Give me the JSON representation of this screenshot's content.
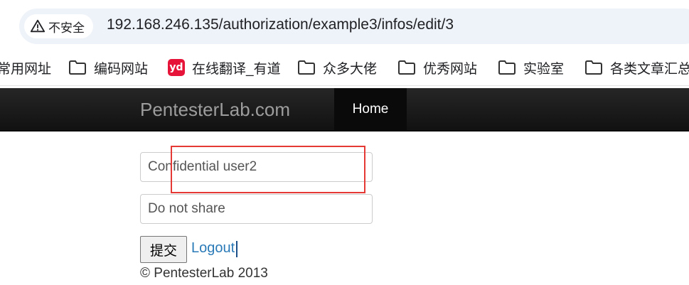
{
  "browser": {
    "security_label": "不安全",
    "url": "192.168.246.135/authorization/example3/infos/edit/3"
  },
  "bookmarks": [
    {
      "label": "常用网址",
      "icon": "none"
    },
    {
      "label": "编码网站",
      "icon": "folder-icon"
    },
    {
      "label": "在线翻译_有道",
      "icon": "youdao-icon"
    },
    {
      "label": "众多大佬",
      "icon": "folder-icon"
    },
    {
      "label": "优秀网站",
      "icon": "folder-icon"
    },
    {
      "label": "实验室",
      "icon": "folder-icon"
    },
    {
      "label": "各类文章汇总",
      "icon": "folder-icon"
    }
  ],
  "youdao_icon_text": "yd",
  "navbar": {
    "brand": "PentesterLab.com",
    "home": "Home"
  },
  "form": {
    "field1_value": "Confidential user2",
    "field2_value": "Do not share",
    "submit_label": "提交",
    "logout_label": "Logout"
  },
  "footer": "© PentesterLab 2013",
  "colors": {
    "highlight": "#e53935",
    "link": "#2a7ab8",
    "navbar": "#1b1b1b"
  }
}
